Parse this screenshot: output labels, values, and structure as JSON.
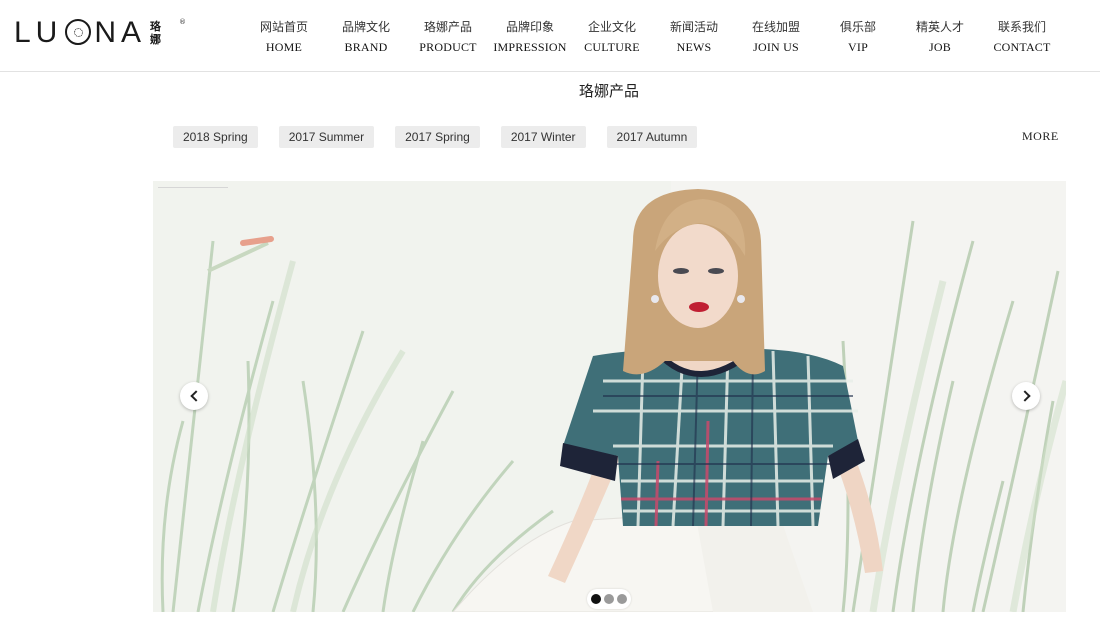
{
  "logo": {
    "wordmark_left": "LU",
    "wordmark_right": "NA",
    "cn_top": "珞",
    "cn_bottom": "娜",
    "registered": "®"
  },
  "nav": [
    {
      "cn": "网站首页",
      "en": "HOME"
    },
    {
      "cn": "品牌文化",
      "en": "BRAND"
    },
    {
      "cn": "珞娜产品",
      "en": "PRODUCT"
    },
    {
      "cn": "品牌印象",
      "en": "IMPRESSION"
    },
    {
      "cn": "企业文化",
      "en": "CULTURE"
    },
    {
      "cn": "新闻活动",
      "en": "NEWS"
    },
    {
      "cn": "在线加盟",
      "en": "JOIN US"
    },
    {
      "cn": "俱乐部",
      "en": "VIP"
    },
    {
      "cn": "精英人才",
      "en": "JOB"
    },
    {
      "cn": "联系我们",
      "en": "CONTACT"
    }
  ],
  "section_title": "珞娜产品",
  "season_tabs": [
    "2018 Spring",
    "2017 Summer",
    "2017 Spring",
    "2017 Winter",
    "2017 Autumn"
  ],
  "more_label": "MORE",
  "banner": {
    "slide_count": 3,
    "active_slide": 1,
    "prev_icon": "chevron-left-icon",
    "next_icon": "chevron-right-icon"
  }
}
